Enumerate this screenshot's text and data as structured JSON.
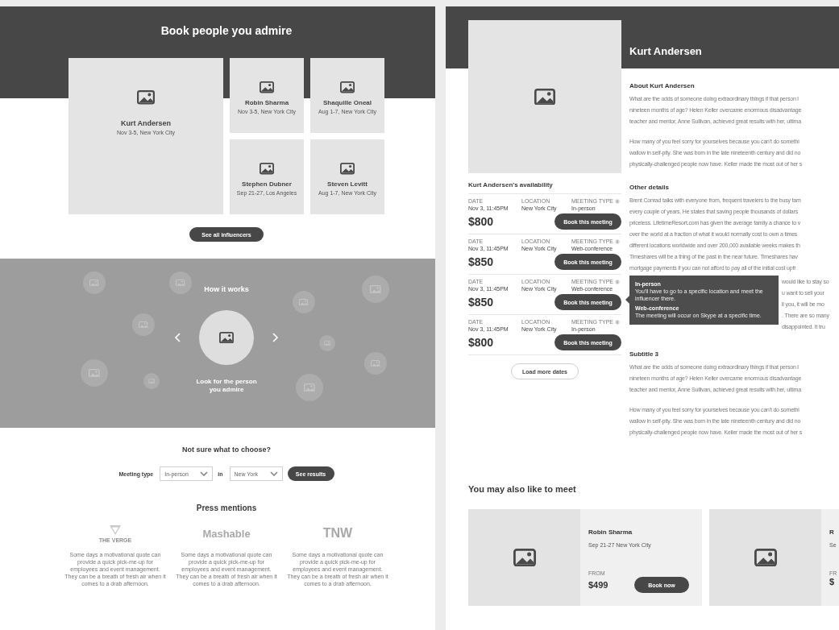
{
  "left_page": {
    "hero": {
      "title": "Book people you admire",
      "featured": {
        "name": "Kurt Andersen",
        "meta": "Nov 3-5, New York City"
      },
      "influencers": [
        {
          "name": "Robin Sharma",
          "meta": "Nov 3-5, New York City"
        },
        {
          "name": "Shaquille Oneal",
          "meta": "Aug 1-7, New York City"
        },
        {
          "name": "Stephen Dubner",
          "meta": "Sep 21-27, Los Angeles"
        },
        {
          "name": "Steven Levitt",
          "meta": "Aug 1-7, New York City"
        }
      ],
      "button": "See all influencers"
    },
    "how_it_works": {
      "title": "How it works",
      "caption": "Look for the person\nyou admire"
    },
    "filter": {
      "title": "Not sure what to choose?",
      "label": "Meeting type",
      "meeting_type": "In-person",
      "connector": "in",
      "location": "New York",
      "button": "See results"
    },
    "press": {
      "title": "Press mentions",
      "items": [
        {
          "kind": "symbol",
          "logo": "THE VERGE",
          "text": "Some days a motivational quote can provide a quick pick-me-up for employees and event management. They can be a breath of fresh air when it comes to a drab afternoon."
        },
        {
          "kind": "wordmark",
          "logo": "Mashable",
          "text": "Some days a motivational quote can provide a quick pick-me-up for employees and event management. They can be a breath of fresh air when it comes to a drab afternoon."
        },
        {
          "kind": "wordmark",
          "logo": "TNW",
          "text": "Some days a motivational quote can provide a quick pick-me-up for employees and event management. They can be a breath of fresh air when it comes to a drab afternoon."
        }
      ]
    }
  },
  "right_page": {
    "name": "Kurt Andersen",
    "availability": {
      "title": "Kurt Andersen's availability",
      "slots": [
        {
          "labels": [
            "DATE",
            "LOCATION",
            "MEETING TYPE"
          ],
          "date": "Nov 3, 11:45PM",
          "location": "New York City",
          "meeting_type": "In-person",
          "price": "$800",
          "button": "Book this meeting"
        },
        {
          "labels": [
            "DATE",
            "LOCATION",
            "MEETING TYPE"
          ],
          "date": "Nov 3, 11:45PM",
          "location": "New York City",
          "meeting_type": "Web-conference",
          "price": "$850",
          "button": "Book this meeting"
        },
        {
          "labels": [
            "DATE",
            "LOCATION",
            "MEETING TYPE"
          ],
          "date": "Nov 3, 11:45PM",
          "location": "New York City",
          "meeting_type": "Web-conference",
          "price": "$850",
          "button": "Book this meeting"
        },
        {
          "labels": [
            "DATE",
            "LOCATION",
            "MEETING TYPE"
          ],
          "date": "Nov 3, 11:45PM",
          "location": "New York City",
          "meeting_type": "In-person",
          "price": "$800",
          "button": "Book this meeting"
        }
      ],
      "load_more": "Load more dates"
    },
    "sections": [
      {
        "kind": "text",
        "heading": "About Kurt Andersen",
        "paragraphs": [
          [
            "What are the odds of someone doing extraordinary things if that person l",
            "nineteen months of age? Helen Keller overcame enormous disadvantage",
            "teacher and mentor, Anne Sullivan, achieved great results with her, ultima"
          ],
          [
            "How many of you feel sorry for yourselves because you can't do somethi",
            "wallow in self-pity. She was born in the late nineteenth century and did no",
            "physically-challenged people now have. Keller made the most out of her s"
          ]
        ]
      },
      {
        "kind": "tooltip",
        "heading": "Other details",
        "lines": [
          "Brent Conrad talks with everyone from, frequent travelers to the busy fam",
          "every couple of years. He states that saving people thousands of dollars",
          "priceless. LifetimeResort.com has given the average family a chance to v",
          "over the world at a fraction of what it would normally cost to own a times",
          "different locations worldwide and over 200,000 available weeks makes th",
          "Timeshares will be a thing of the past in the near future. Timeshares hav",
          "mortgage payments if you can not afford to pay all of the initial cost upfr"
        ],
        "tooltip": [
          {
            "title": "In-person",
            "text": "You'll have to go to a specific location and meet the influencer there."
          },
          {
            "title": "Web-conference",
            "text": "The meeting will occur on Skype at a specific time."
          }
        ],
        "side_lines": [
          "would like to stay so",
          "u want to sell your",
          "ll you, it will be mo",
          ". There are so many",
          "disappointed. It tru"
        ]
      },
      {
        "kind": "text",
        "heading": "Subtitle 3",
        "paragraphs": [
          [
            "What are the odds of someone doing extraordinary things if that person l",
            "nineteen months of age? Helen Keller overcame enormous disadvantage",
            "teacher and mentor, Anne Sullivan, achieved great results with her, ultima"
          ],
          [
            "How many of you feel sorry for yourselves because you can't do somethi",
            "wallow in self-pity. She was born in the late nineteenth century and did no",
            "physically-challenged people now have. Keller made the most out of her s"
          ]
        ]
      }
    ],
    "suggestions": {
      "title": "You may also like to meet",
      "cards": [
        {
          "name": "Robin Sharma",
          "meta": "Sep 21-27 New York City",
          "from_label": "FROM",
          "price": "$499",
          "button": "Book now"
        },
        {
          "name": "R",
          "meta": "Se",
          "from_label": "FR",
          "price": "$"
        }
      ]
    }
  }
}
